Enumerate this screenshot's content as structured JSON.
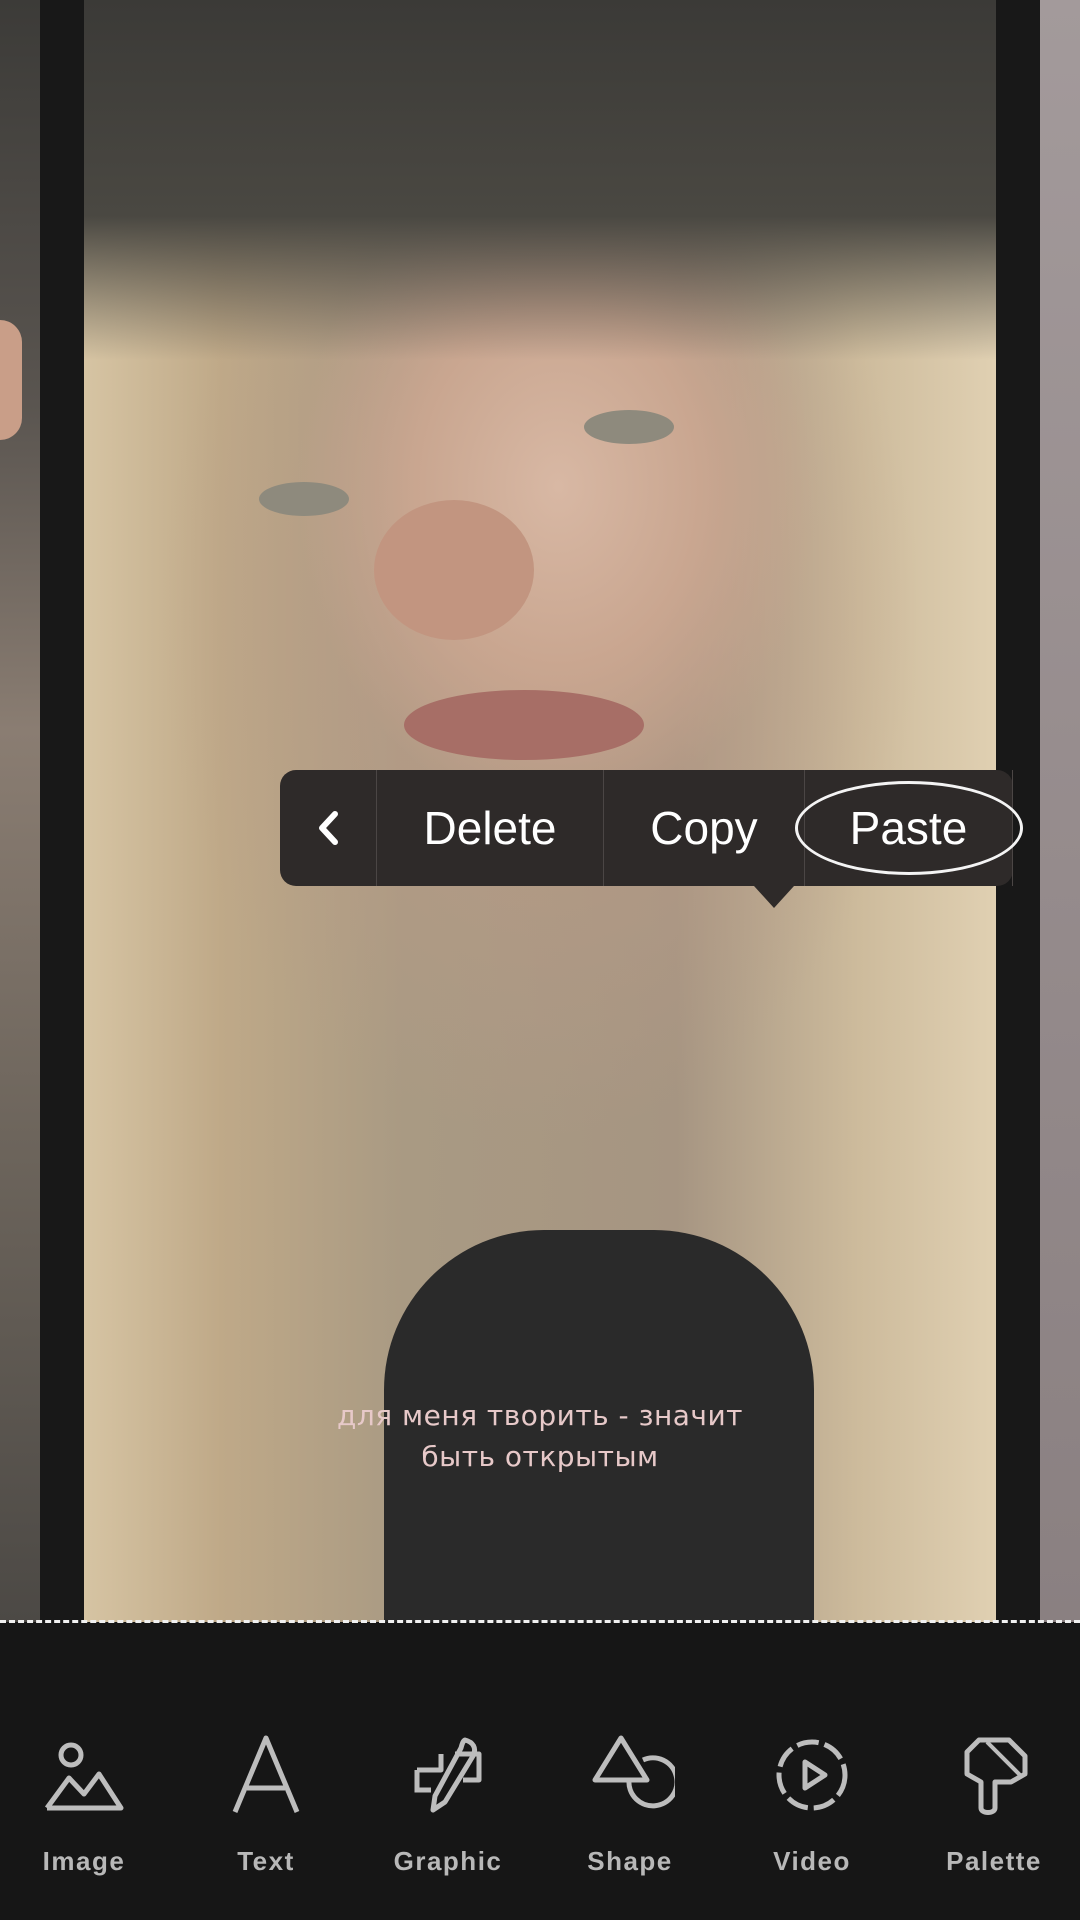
{
  "canvas": {
    "caption_line1": "для меня творить - значит",
    "caption_line2": "быть открытым"
  },
  "context_menu": {
    "back_icon": "chevron-left-icon",
    "delete_label": "Delete",
    "copy_label": "Copy",
    "paste_label": "Paste"
  },
  "toolbar": {
    "items": [
      {
        "label": "Image",
        "icon": "image-icon"
      },
      {
        "label": "Text",
        "icon": "text-icon"
      },
      {
        "label": "Graphic",
        "icon": "graphic-icon"
      },
      {
        "label": "Shape",
        "icon": "shape-icon"
      },
      {
        "label": "Video",
        "icon": "video-icon"
      },
      {
        "label": "Palette",
        "icon": "palette-icon"
      }
    ]
  },
  "colors": {
    "background": "#161616",
    "menu": "#2e2a29",
    "caption": "#e7c9c9",
    "toolbar_icon": "#bdbdbd"
  }
}
